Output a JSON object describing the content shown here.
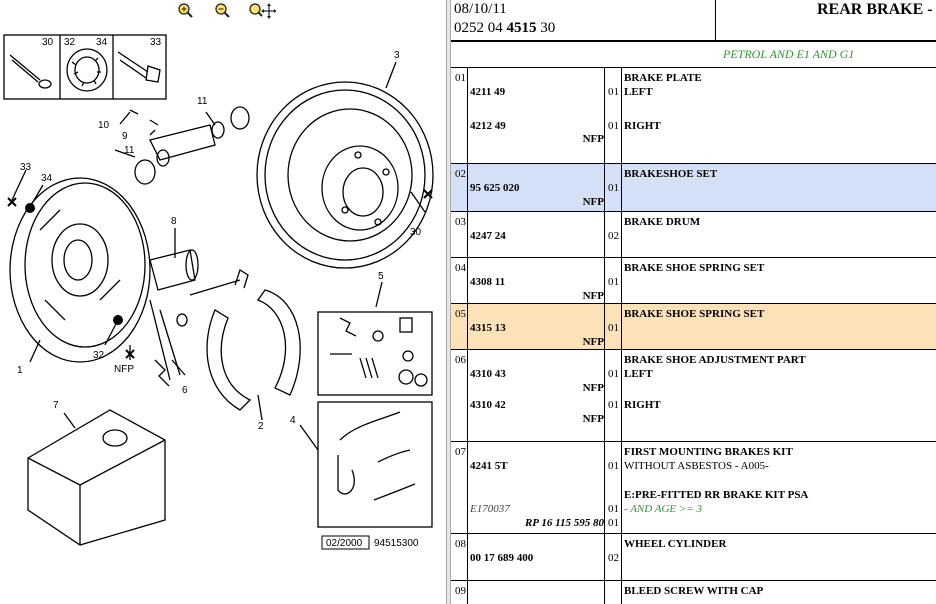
{
  "toolbar": {
    "zoom_in_icon": "zoom-in-icon",
    "zoom_out_icon": "zoom-out-icon",
    "pan_zoom_icon": "pan-zoom-icon"
  },
  "diagram": {
    "callouts": [
      "30",
      "32",
      "34",
      "33",
      "3",
      "10",
      "9",
      "11",
      "11",
      "33",
      "34",
      "8",
      "30",
      "5",
      "1",
      "32",
      "NFP",
      "6",
      "4",
      "2",
      "7"
    ],
    "footer_date": "02/2000",
    "footer_code": "94515300"
  },
  "header": {
    "date": "08/10/11",
    "ref_prefix": "0252 04 ",
    "ref_bold": "4515",
    "ref_suffix": " 30",
    "title": "REAR BRAKE - "
  },
  "filter_label": "PETROL AND E1 AND G1",
  "rows": [
    {
      "idx": "01",
      "lines": [
        {
          "part": "4211 49",
          "qty": "01",
          "desc": "BRAKE PLATE",
          "sub": "LEFT"
        },
        {
          "part": "4212 49",
          "nfp": "NFP",
          "qty": "01",
          "sub": "RIGHT"
        }
      ]
    },
    {
      "idx": "02",
      "part": "95 625 020",
      "nfp": "NFP",
      "qty": "01",
      "desc": "BRAKESHOE SET"
    },
    {
      "idx": "03",
      "part": "4247 24",
      "qty": "02",
      "desc": "BRAKE DRUM"
    },
    {
      "idx": "04",
      "part": "4308 11",
      "nfp": "NFP",
      "qty": "01",
      "desc": "BRAKE SHOE SPRING SET"
    },
    {
      "idx": "05",
      "part": "4315 13",
      "nfp": "NFP",
      "qty": "01",
      "desc": "BRAKE SHOE SPRING SET"
    },
    {
      "idx": "06",
      "desc": "BRAKE SHOE ADJUSTMENT PART",
      "lines": [
        {
          "part": "4310 43",
          "nfp": "NFP",
          "qty": "01",
          "sub": "LEFT"
        },
        {
          "part": "4310 42",
          "nfp": "NFP",
          "qty": "01",
          "sub": "RIGHT"
        }
      ]
    },
    {
      "idx": "07",
      "part": "4241 5T",
      "qty": "01",
      "desc": "FIRST MOUNTING BRAKES KIT",
      "sub": "WITHOUT ASBESTOS - A005-",
      "extra_desc": "E:PRE-FITTED RR BRAKE KIT PSA",
      "extra_green": "- AND AGE >= 3",
      "extra_ref": "E170037",
      "extra_part": "RP 16 115 595 80",
      "extra_qty1": "01",
      "extra_qty2": "01"
    },
    {
      "idx": "08",
      "part": "00 17 689 400",
      "qty": "02",
      "desc": "WHEEL CYLINDER"
    },
    {
      "idx": "09",
      "desc": "BLEED SCREW WITH CAP"
    }
  ],
  "colors": {
    "row_blue": "#d3e0f6",
    "row_orange": "#fde2b7",
    "green_text": "#2a9a2a"
  }
}
